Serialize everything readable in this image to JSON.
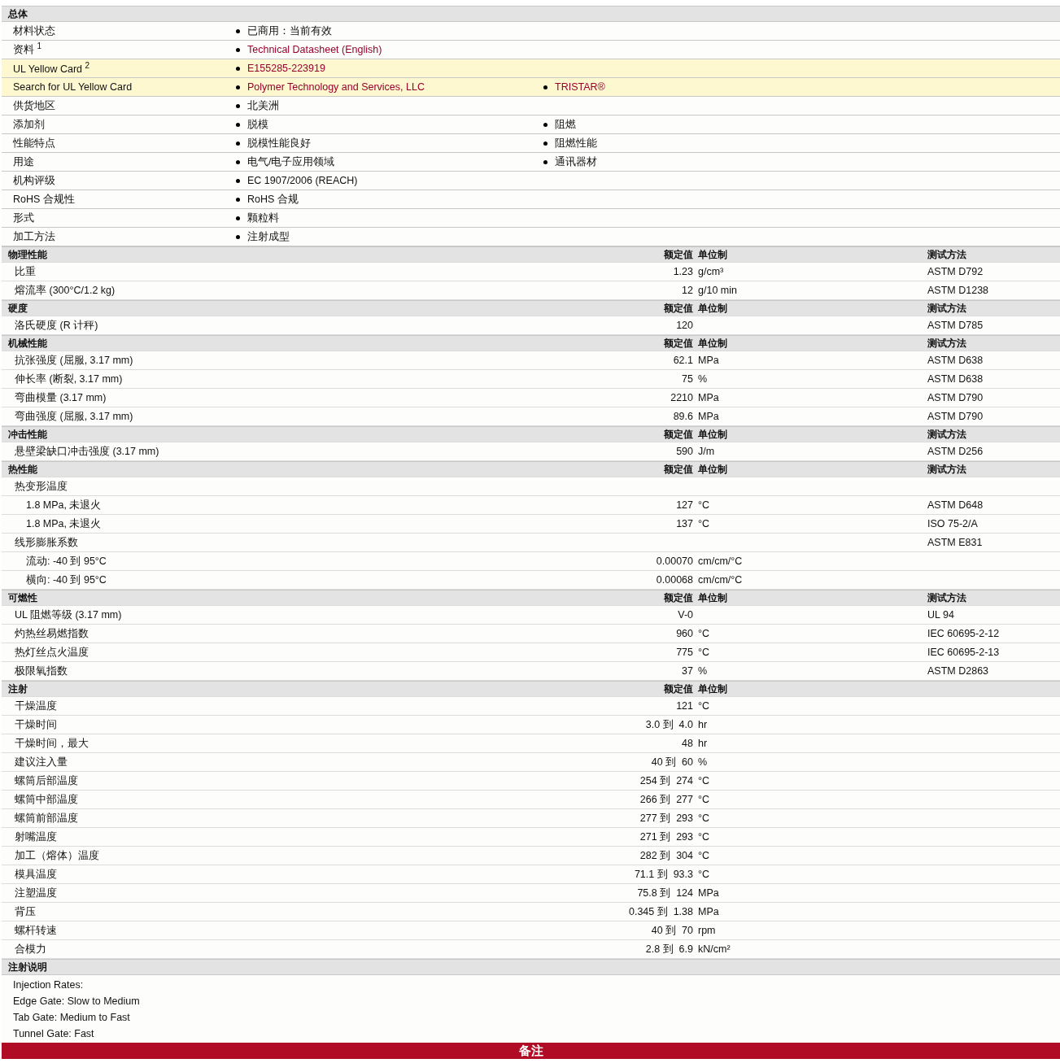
{
  "general": {
    "title": "总体",
    "rows": [
      {
        "label": "材料状态",
        "highlighted": false,
        "values": [
          {
            "text": "已商用：当前有效",
            "link": false
          }
        ]
      },
      {
        "label": "资料 $^{1}$",
        "highlighted": false,
        "values": [
          {
            "text": "Technical Datasheet (English)",
            "link": true
          }
        ]
      },
      {
        "label": "UL Yellow Card $^{2}$",
        "highlighted": true,
        "values": [
          {
            "text": "E155285-223919",
            "link": true
          }
        ]
      },
      {
        "label": "Search for UL Yellow Card",
        "highlighted": true,
        "values": [
          {
            "text": "Polymer Technology and Services, LLC",
            "link": true
          },
          {
            "text": "TRISTAR®",
            "link": true
          }
        ]
      },
      {
        "label": "供货地区",
        "highlighted": false,
        "values": [
          {
            "text": "北美洲",
            "link": false
          }
        ]
      },
      {
        "label": "添加剂",
        "highlighted": false,
        "values": [
          {
            "text": "脱模",
            "link": false
          },
          {
            "text": "阻燃",
            "link": false
          }
        ]
      },
      {
        "label": "性能特点",
        "highlighted": false,
        "values": [
          {
            "text": "脱模性能良好",
            "link": false
          },
          {
            "text": "阻燃性能",
            "link": false
          }
        ]
      },
      {
        "label": "用途",
        "highlighted": false,
        "values": [
          {
            "text": "电气/电子应用领域",
            "link": false
          },
          {
            "text": "通讯器材",
            "link": false
          }
        ]
      },
      {
        "label": "机构评级",
        "highlighted": false,
        "values": [
          {
            "text": "EC 1907/2006 (REACH)",
            "link": false
          }
        ]
      },
      {
        "label": "RoHS 合规性",
        "highlighted": false,
        "values": [
          {
            "text": "RoHS 合规",
            "link": false
          }
        ]
      },
      {
        "label": "形式",
        "highlighted": false,
        "values": [
          {
            "text": "颗粒料",
            "link": false
          }
        ]
      },
      {
        "label": "加工方法",
        "highlighted": false,
        "values": [
          {
            "text": "注射成型",
            "link": false
          }
        ]
      }
    ]
  },
  "sections": [
    {
      "title": "物理性能",
      "columns": [
        "额定值",
        "单位制",
        "测试方法"
      ],
      "rows": [
        {
          "label": "比重",
          "value": "1.23",
          "unit": "g/cm³",
          "method": "ASTM D792"
        },
        {
          "label": "熔流率 (300°C/1.2 kg)",
          "value": "12",
          "unit": "g/10 min",
          "method": "ASTM D1238"
        }
      ]
    },
    {
      "title": "硬度",
      "columns": [
        "额定值",
        "单位制",
        "测试方法"
      ],
      "rows": [
        {
          "label": "洛氏硬度 (R 计秤)",
          "value": "120",
          "method": "ASTM D785"
        }
      ]
    },
    {
      "title": "机械性能",
      "columns": [
        "额定值",
        "单位制",
        "测试方法"
      ],
      "rows": [
        {
          "label": "抗张强度 (屈服, 3.17 mm)",
          "value": "62.1",
          "unit": "MPa",
          "method": "ASTM D638"
        },
        {
          "label": "伸长率 (断裂, 3.17 mm)",
          "value": "75",
          "unit": "%",
          "method": "ASTM D638"
        },
        {
          "label": "弯曲模量 (3.17 mm)",
          "value": "2210",
          "unit": "MPa",
          "method": "ASTM D790"
        },
        {
          "label": "弯曲强度 (屈服, 3.17 mm)",
          "value": "89.6",
          "unit": "MPa",
          "method": "ASTM D790"
        }
      ]
    },
    {
      "title": "冲击性能",
      "columns": [
        "额定值",
        "单位制",
        "测试方法"
      ],
      "rows": [
        {
          "label": "悬壁梁缺口冲击强度 (3.17 mm)",
          "value": "590",
          "unit": "J/m",
          "method": "ASTM D256"
        }
      ]
    },
    {
      "title": "热性能",
      "columns": [
        "额定值",
        "单位制",
        "测试方法"
      ],
      "rows": [
        {
          "label": "热变形温度",
          "children": [
            {
              "label": "1.8 MPa, 未退火",
              "value": "127",
              "unit": "°C",
              "method": "ASTM D648"
            },
            {
              "label": "1.8 MPa, 未退火",
              "value": "137",
              "unit": "°C",
              "method": "ISO 75-2/A"
            }
          ]
        },
        {
          "label": "线形膨胀系数",
          "method": "ASTM E831",
          "children": [
            {
              "label": "流动: -40 到  95°C",
              "value": "0.00070",
              "unit": "cm/cm/°C"
            },
            {
              "label": "横向: -40 到  95°C",
              "value": "0.00068",
              "unit": "cm/cm/°C"
            }
          ]
        }
      ]
    },
    {
      "title": "可燃性",
      "columns": [
        "额定值",
        "单位制",
        "测试方法"
      ],
      "rows": [
        {
          "label": "UL 阻燃等级 (3.17 mm)",
          "value": "V-0",
          "method": "UL 94"
        },
        {
          "label": "灼热丝易燃指数",
          "value": "960",
          "unit": "°C",
          "method": "IEC 60695-2-12"
        },
        {
          "label": "热灯丝点火温度",
          "value": "775",
          "unit": "°C",
          "method": "IEC 60695-2-13"
        },
        {
          "label": "极限氧指数",
          "value": "37",
          "unit": "%",
          "method": "ASTM D2863"
        }
      ]
    },
    {
      "title": "注射",
      "columns": [
        "额定值",
        "单位制"
      ],
      "rows": [
        {
          "label": "干燥温度",
          "value": "121",
          "unit": "°C"
        },
        {
          "label": "干燥时间",
          "value": "3.0 到  4.0",
          "unit": "hr"
        },
        {
          "label": "干燥时间，最大",
          "value": "48",
          "unit": "hr"
        },
        {
          "label": "建议注入量",
          "value": "40 到  60",
          "unit": "%"
        },
        {
          "label": "螺筒后部温度",
          "value": "254 到  274",
          "unit": "°C"
        },
        {
          "label": "螺筒中部温度",
          "value": "266 到  277",
          "unit": "°C"
        },
        {
          "label": "螺筒前部温度",
          "value": "277 到  293",
          "unit": "°C"
        },
        {
          "label": "射嘴温度",
          "value": "271 到  293",
          "unit": "°C"
        },
        {
          "label": "加工（熔体）温度",
          "value": "282 到  304",
          "unit": "°C"
        },
        {
          "label": "模具温度",
          "value": "71.1 到  93.3",
          "unit": "°C"
        },
        {
          "label": "注塑温度",
          "value": "75.8 到  124",
          "unit": "MPa"
        },
        {
          "label": "背压",
          "value": "0.345 到  1.38",
          "unit": "MPa"
        },
        {
          "label": "螺杆转速",
          "value": "40 到  70",
          "unit": "rpm"
        },
        {
          "label": "合模力",
          "value": "2.8 到  6.9",
          "unit": "kN/cm²"
        }
      ]
    }
  ],
  "notes": {
    "title": "注射说明",
    "lines": [
      "Injection Rates:",
      "Edge Gate: Slow to Medium",
      "Tab Gate: Medium to Fast",
      "Tunnel Gate: Fast"
    ]
  },
  "banner": "备注"
}
